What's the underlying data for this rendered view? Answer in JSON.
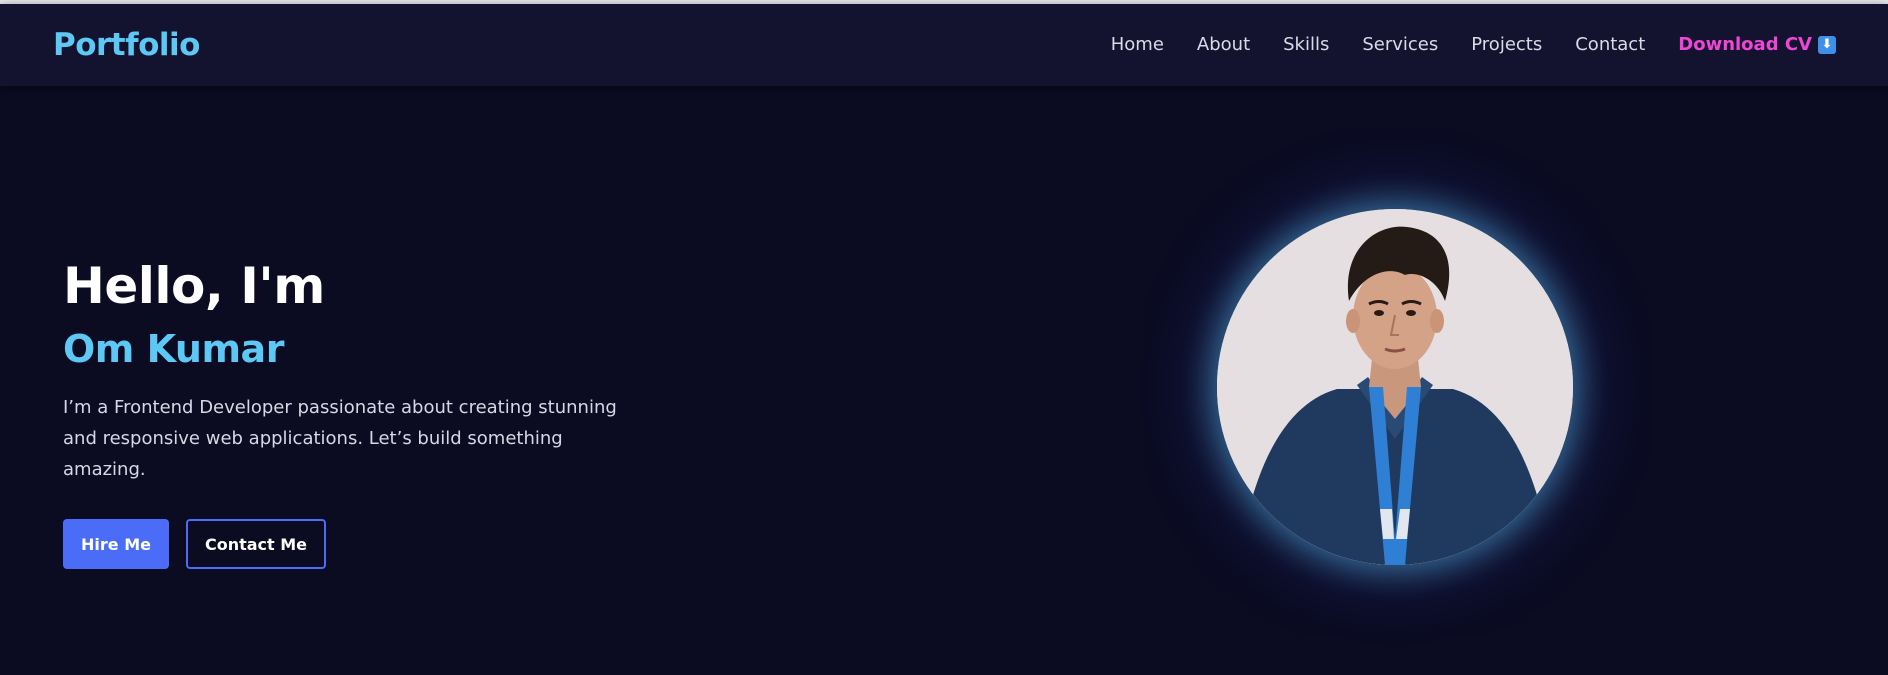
{
  "brand": "Portfolio",
  "nav": {
    "items": [
      {
        "label": "Home"
      },
      {
        "label": "About"
      },
      {
        "label": "Skills"
      },
      {
        "label": "Services"
      },
      {
        "label": "Projects"
      },
      {
        "label": "Contact"
      }
    ],
    "download_cv": {
      "label": "Download CV",
      "icon": "⬇"
    }
  },
  "hero": {
    "greeting": "Hello, I'm",
    "name": "Om Kumar",
    "tagline_line1": "I’m a Frontend Developer passionate about creating stunning",
    "tagline_line2": "and responsive web applications. Let’s build something amazing.",
    "hire_label": "Hire Me",
    "contact_label": "Contact Me"
  },
  "colors": {
    "background": "#0b0b22",
    "navbar": "#13132f",
    "accent_cyan": "#5ec8f5",
    "accent_pink": "#ee47d6",
    "button_blue": "#4a6cf7"
  }
}
